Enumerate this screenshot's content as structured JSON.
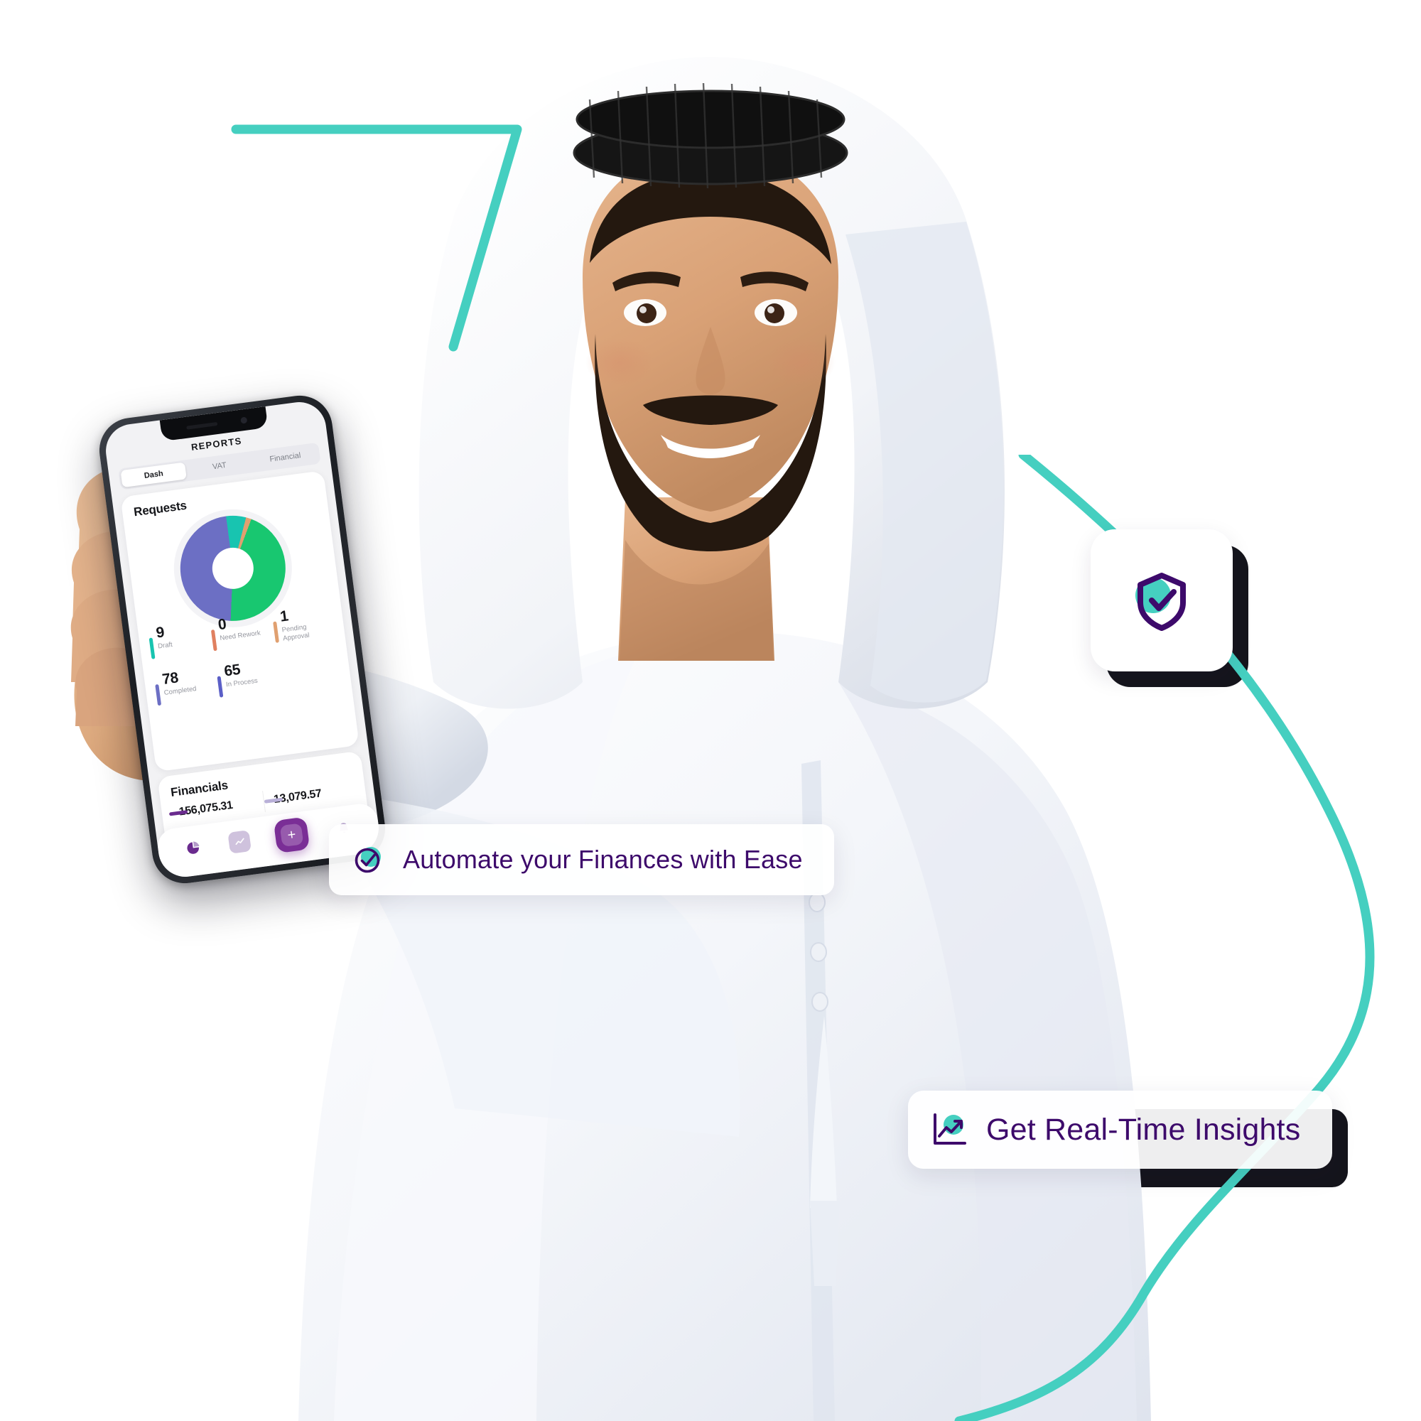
{
  "scene": {
    "title": "Finance App Hero Banner",
    "subject": "man-in-kandura-holding-phone"
  },
  "colors": {
    "teal": "#45cfc0",
    "purple": "#3d0a6b",
    "purple_accent": "#7a2e96",
    "green": "#18c770",
    "periwinkle": "#6c6fc4",
    "orange": "#e08060",
    "dark": "#15151c"
  },
  "phone": {
    "app_title": "REPORTS",
    "tabs": [
      {
        "label": "Dash",
        "active": true
      },
      {
        "label": "VAT",
        "active": false
      },
      {
        "label": "Financial",
        "active": false
      }
    ],
    "requests": {
      "heading": "Requests",
      "stats": [
        {
          "value": "9",
          "label": "Draft",
          "color": "#18c4b0"
        },
        {
          "value": "0",
          "label": "Need Rework",
          "color": "#e08060"
        },
        {
          "value": "1",
          "label": "Pending Approval",
          "color": "#e0a070"
        },
        {
          "value": "78",
          "label": "Completed",
          "color": "#6c6fc4"
        },
        {
          "value": "65",
          "label": "In Process",
          "color": "#5b5fc7"
        }
      ]
    },
    "financials": {
      "heading": "Financials",
      "values": [
        {
          "amount": "156,075.31",
          "color": "#6a2b8e"
        },
        {
          "amount": "13,079.57",
          "color": "#b9b0d8"
        }
      ]
    },
    "bottom_nav": [
      {
        "icon": "pie-chart-icon",
        "active": false
      },
      {
        "icon": "analytics-icon",
        "active": false
      },
      {
        "icon": "add-icon",
        "active": true
      },
      {
        "icon": "bell-icon",
        "active": false
      }
    ]
  },
  "badges": [
    {
      "id": "automate",
      "icon": "check-circle-icon",
      "text": "Automate your Finances with Ease"
    },
    {
      "id": "insights",
      "icon": "chart-trending-up-icon",
      "text": "Get Real-Time Insights"
    }
  ],
  "shield_card": {
    "icon": "shield-check-icon"
  },
  "chart_data": {
    "type": "pie",
    "title": "Requests",
    "categories": [
      "In Process",
      "Draft",
      "Pending Approval",
      "Completed"
    ],
    "values": [
      65,
      9,
      1,
      78
    ],
    "colors": [
      "#6c6fc4",
      "#18c4b0",
      "#e0a070",
      "#18c770"
    ],
    "legend": "below",
    "grid": false,
    "xlabel": "",
    "ylabel": ""
  }
}
